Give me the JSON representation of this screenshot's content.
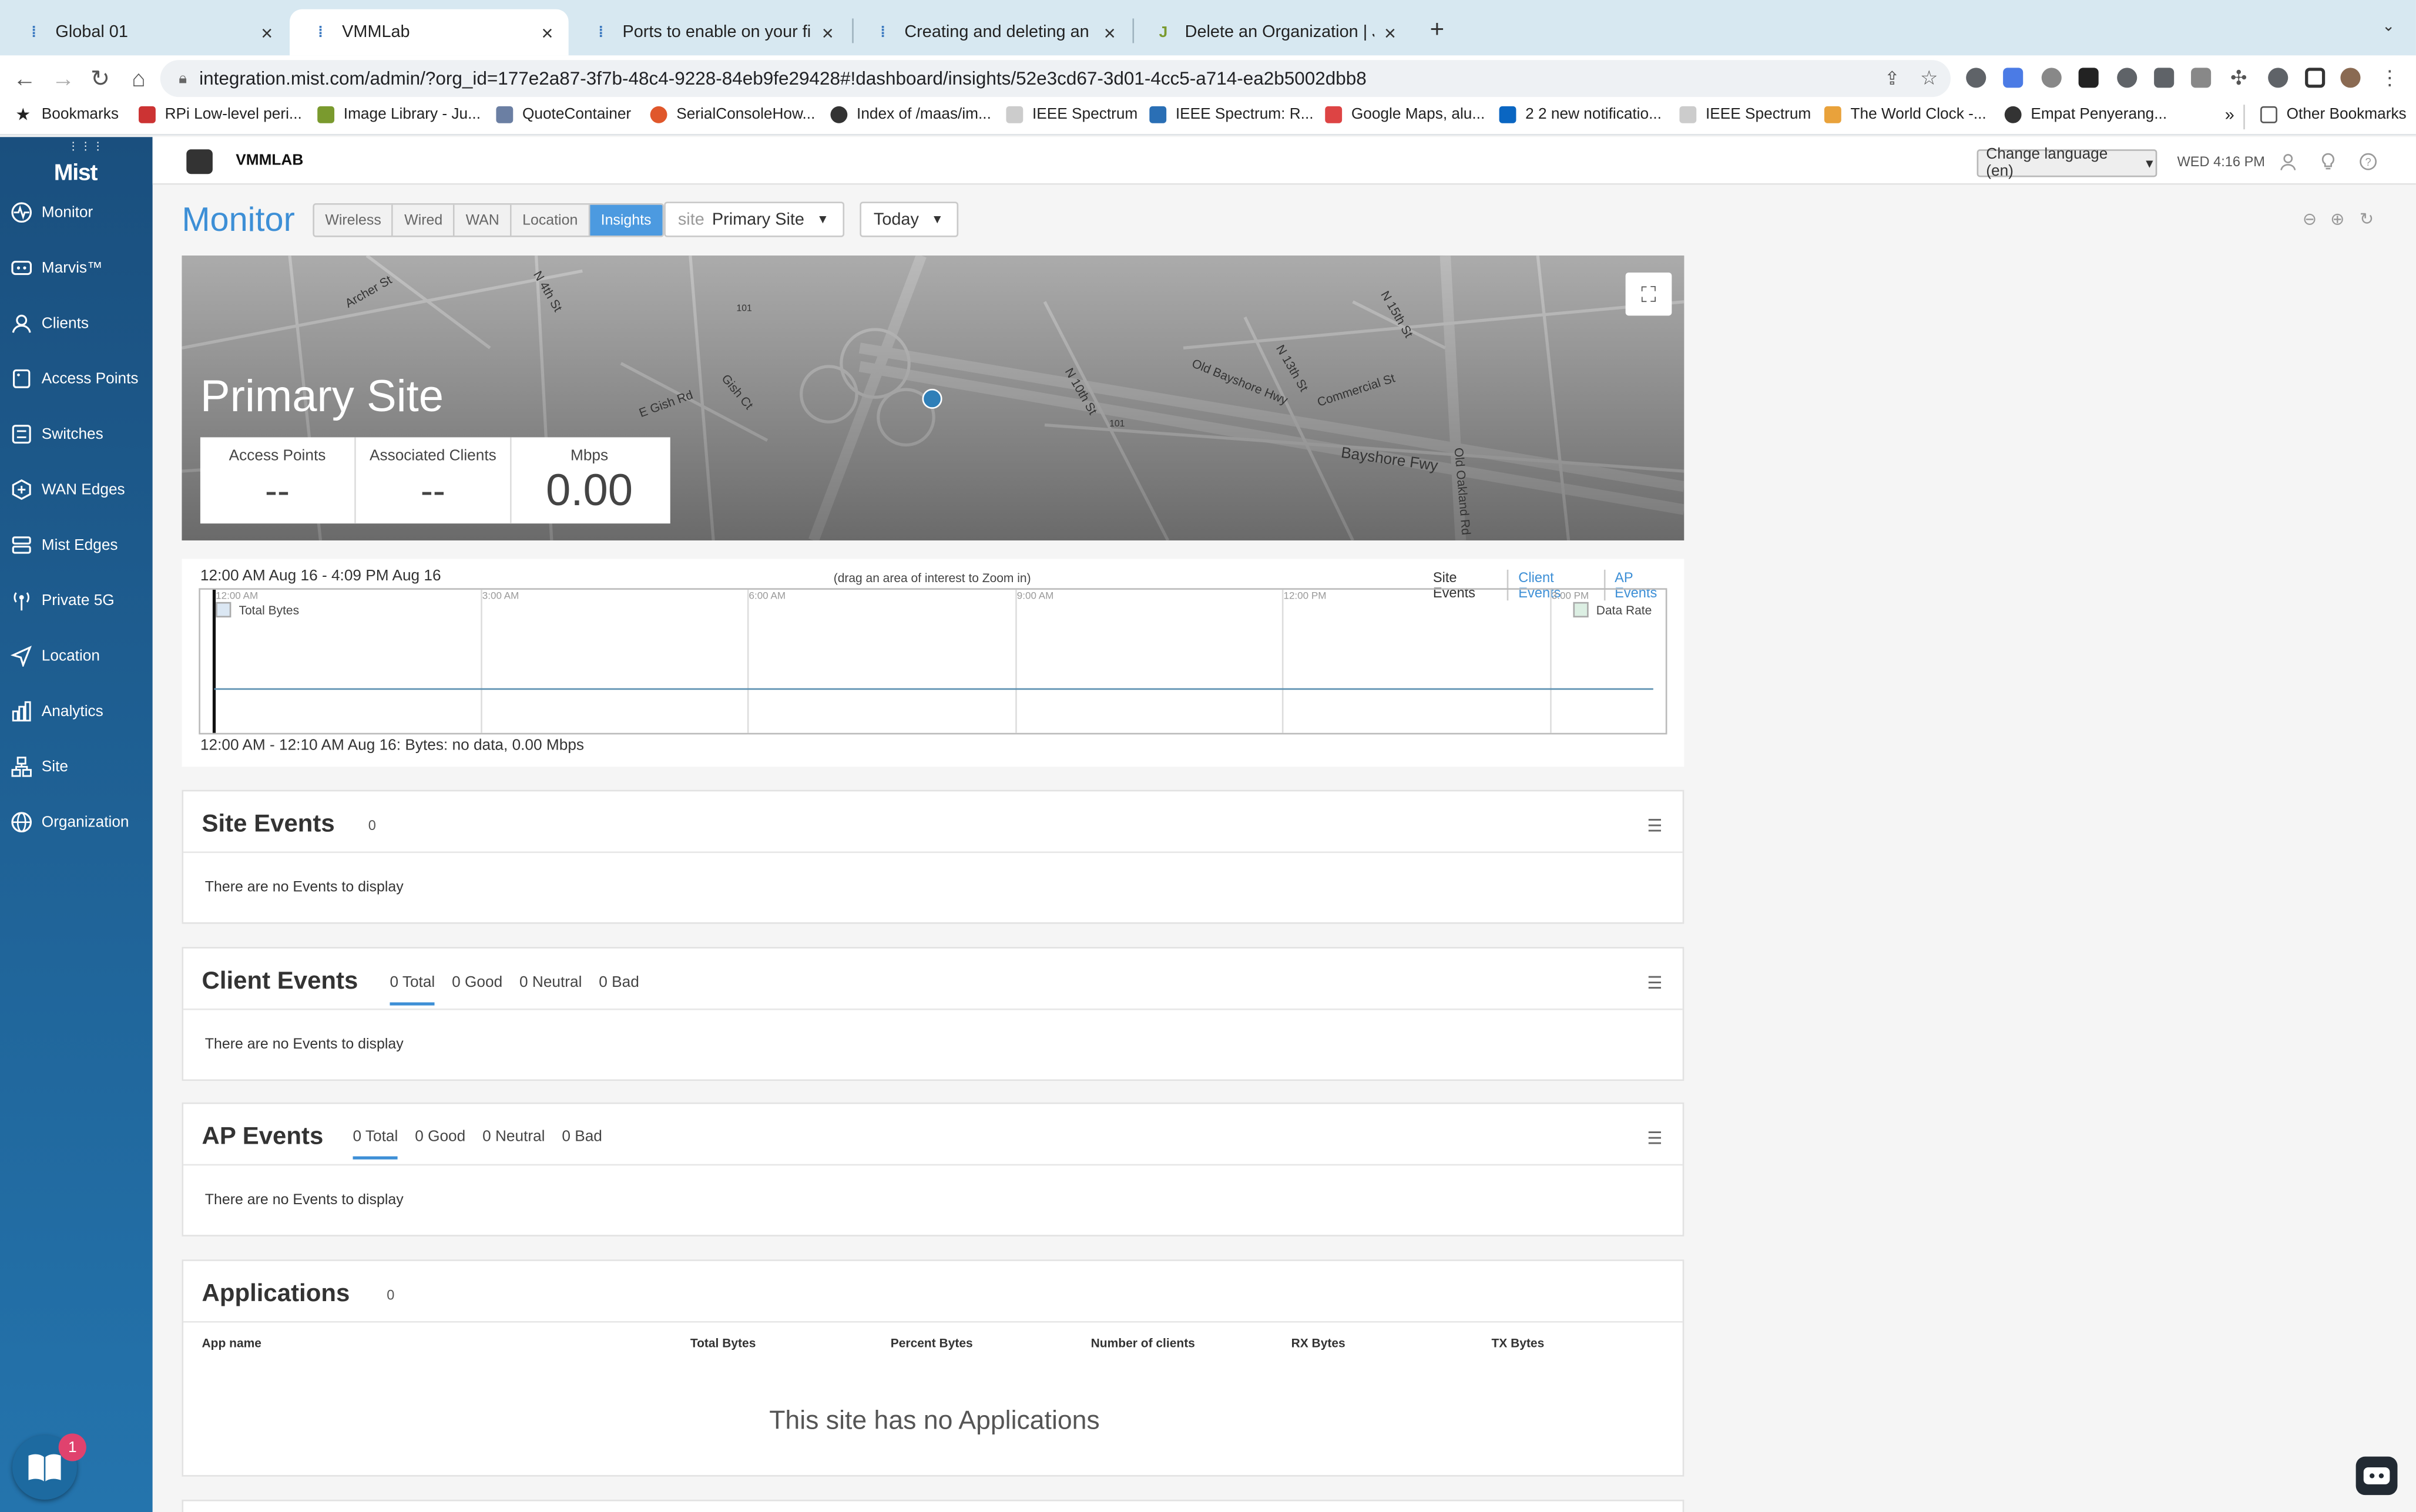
{
  "browser": {
    "tabs": [
      {
        "title": "Global 01",
        "close": "×"
      },
      {
        "title": "VMMLab",
        "close": "×"
      },
      {
        "title": "Ports to enable on your firewall",
        "close": "×"
      },
      {
        "title": "Creating and deleting an Organ",
        "close": "×"
      },
      {
        "title": "Delete an Organization | Junipe",
        "close": "×"
      }
    ],
    "new_tab": "+",
    "url": "integration.mist.com/admin/?org_id=177e2a87-3f7b-48c4-9228-84eb9fe29428#!dashboard/insights/52e3cd67-3d01-4cc5-a714-ea2b5002dbb8",
    "bookmarks": [
      "Bookmarks",
      "RPi Low-level peri...",
      "Image Library - Ju...",
      "QuoteContainer",
      "SerialConsoleHow...",
      "Index of /maas/im...",
      "IEEE Spectrum",
      "IEEE Spectrum: R...",
      "Google Maps, alu...",
      "2 2 new notificatio...",
      "IEEE Spectrum",
      "The World Clock -...",
      "Empat Penyerang..."
    ],
    "bookmarks_more": "»",
    "other_bookmarks": "Other Bookmarks"
  },
  "sidebar": {
    "logo": "Mist",
    "items": [
      {
        "label": "Monitor",
        "icon": "monitor-icon"
      },
      {
        "label": "Marvis™",
        "icon": "marvis-icon"
      },
      {
        "label": "Clients",
        "icon": "clients-icon"
      },
      {
        "label": "Access Points",
        "icon": "access-point-icon"
      },
      {
        "label": "Switches",
        "icon": "switch-icon"
      },
      {
        "label": "WAN Edges",
        "icon": "wan-edge-icon"
      },
      {
        "label": "Mist Edges",
        "icon": "mist-edge-icon"
      },
      {
        "label": "Private 5G",
        "icon": "private-5g-icon"
      },
      {
        "label": "Location",
        "icon": "location-icon"
      },
      {
        "label": "Analytics",
        "icon": "analytics-icon"
      },
      {
        "label": "Site",
        "icon": "site-icon"
      },
      {
        "label": "Organization",
        "icon": "organization-icon"
      }
    ],
    "help_badge": "1"
  },
  "header": {
    "org_name": "VMMLAB",
    "language": "Change language (en)",
    "datetime": "WED 4:16 PM"
  },
  "monitor": {
    "title": "Monitor",
    "tabs": [
      "Wireless",
      "Wired",
      "WAN",
      "Location",
      "Insights"
    ],
    "active_tab": "Insights",
    "site_prefix": "site",
    "site_value": "Primary Site",
    "period": "Today"
  },
  "map": {
    "site_name": "Primary Site",
    "streets": [
      "Archer St",
      "N 4th St",
      "E Gish Rd",
      "Gish Ct",
      "N 10th St",
      "Old Bayshore Hwy",
      "N 13th St",
      "Commercial St",
      "N 15th St",
      "Bayshore Fwy",
      "Old Oakland Rd",
      "101",
      "101"
    ],
    "stats": [
      {
        "label": "Access Points",
        "value": "--"
      },
      {
        "label": "Associated Clients",
        "value": "--"
      },
      {
        "label": "Mbps",
        "value": "0.00"
      }
    ]
  },
  "timeline": {
    "range": "12:00 AM Aug 16 - 4:09 PM Aug 16",
    "hint": "(drag an area of interest to Zoom in)",
    "legend": [
      "Site Events",
      "Client Events",
      "AP Events"
    ],
    "ticks": [
      "12:00 AM",
      "3:00 AM",
      "6:00 AM",
      "9:00 AM",
      "12:00 PM",
      "3:00 PM"
    ],
    "series": [
      "Total Bytes",
      "Data Rate"
    ],
    "status": "12:00 AM - 12:10 AM Aug 16: Bytes: no data, 0.00 Mbps"
  },
  "site_events": {
    "title": "Site Events",
    "count": "0",
    "empty": "There are no Events to display"
  },
  "client_events": {
    "title": "Client Events",
    "tabs": [
      "0 Total",
      "0 Good",
      "0 Neutral",
      "0 Bad"
    ],
    "empty": "There are no Events to display"
  },
  "ap_events": {
    "title": "AP Events",
    "tabs": [
      "0 Total",
      "0 Good",
      "0 Neutral",
      "0 Bad"
    ],
    "empty": "There are no Events to display"
  },
  "applications": {
    "title": "Applications",
    "count": "0",
    "columns": [
      "App name",
      "Total Bytes",
      "Percent Bytes",
      "Number of clients",
      "RX Bytes",
      "TX Bytes"
    ],
    "empty": "This site has no Applications"
  },
  "colors": {
    "accent": "#3d8fd6",
    "sidebar": "#1e5f93",
    "tab_strip": "#d7e8f1",
    "badge": "#e0426e"
  }
}
